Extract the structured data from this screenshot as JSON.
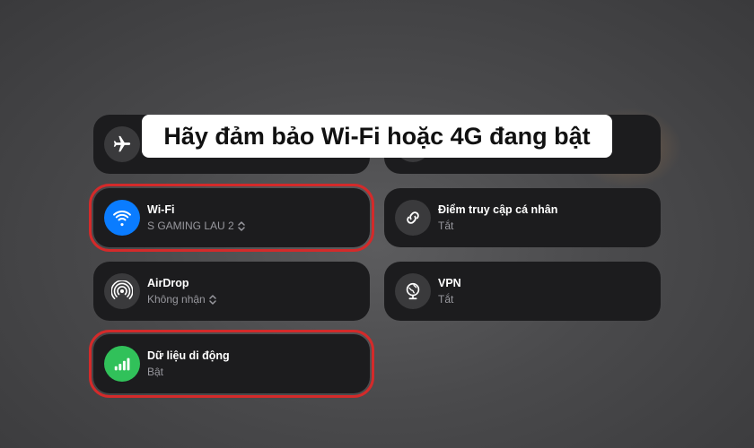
{
  "banner": {
    "text": "Hãy đảm bảo Wi-Fi hoặc 4G đang bật"
  },
  "tiles": {
    "airplane": {
      "icon": "airplane-icon"
    },
    "top_right": {
      "icon": "cellular-icon"
    },
    "wifi": {
      "title": "Wi-Fi",
      "subtitle": "S GAMING LAU 2",
      "icon": "wifi-icon",
      "color": "#0a7cff"
    },
    "hotspot": {
      "title": "Điểm truy cập cá nhân",
      "subtitle": "Tắt",
      "icon": "hotspot-link-icon"
    },
    "airdrop": {
      "title": "AirDrop",
      "subtitle": "Không nhận",
      "icon": "airdrop-icon"
    },
    "vpn": {
      "title": "VPN",
      "subtitle": "Tắt",
      "icon": "vpn-globe-icon"
    },
    "cellular": {
      "title": "Dữ liệu di động",
      "subtitle": "Bật",
      "icon": "cellular-bars-icon",
      "color": "#31c15a"
    }
  },
  "highlight_color": "#d42a2a"
}
